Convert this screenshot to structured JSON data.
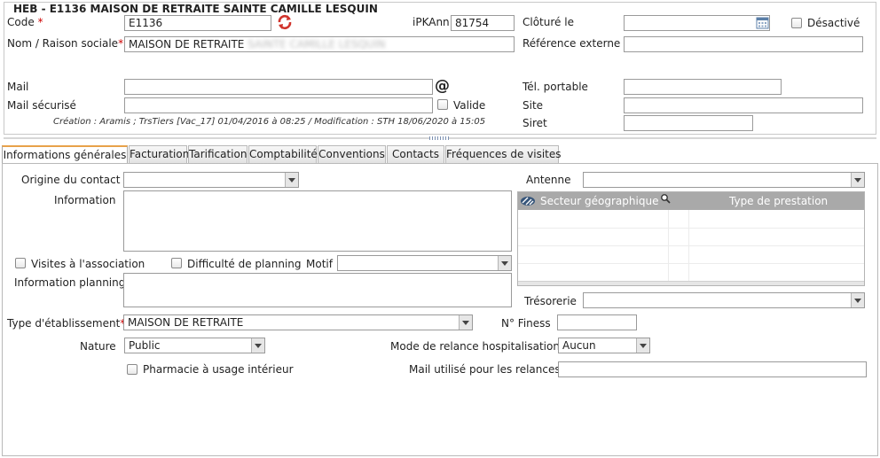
{
  "header": {
    "title": "HEB - E1136 MAISON DE RETRAITE SAINTE CAMILLE LESQUIN",
    "code_label": "Code",
    "code_value": "E1136",
    "ipkann_label": "iPKAnn",
    "ipkann_value": "81754",
    "cloture_label": "Clôturé le",
    "cloture_value": "",
    "desactive_label": "Désactivé",
    "nom_label": "Nom / Raison sociale",
    "nom_value": "MAISON DE RETRAITE",
    "nom_value_blurred": "SAINTE CAMILLE LESQUIN",
    "ref_externe_label": "Référence externe",
    "ref_externe_value": "",
    "mail_label": "Mail",
    "mail_value": "",
    "mail_securise_label": "Mail sécurisé",
    "mail_securise_value": "",
    "valide_label": "Valide",
    "tel_portable_label": "Tél. portable",
    "tel_portable_value": "",
    "site_label": "Site",
    "site_value": "",
    "siret_label": "Siret",
    "siret_value": "",
    "creation_info": "Création : Aramis ; TrsTiers [Vac_17] 01/04/2016 à 08:25 / Modification : STH 18/06/2020 à 15:05",
    "at_symbol": "@"
  },
  "tabs": [
    {
      "label": "Informations générales",
      "active": true
    },
    {
      "label": "Facturation"
    },
    {
      "label": "Tarification"
    },
    {
      "label": "Comptabilité"
    },
    {
      "label": "Conventions"
    },
    {
      "label": "Contacts"
    },
    {
      "label": "Fréquences de visites"
    }
  ],
  "general": {
    "origine_label": "Origine du contact",
    "origine_value": "",
    "information_label": "Information",
    "information_value": "",
    "visites_label": "Visites à l'association",
    "difficulte_label": "Difficulté de planning",
    "motif_label": "Motif",
    "motif_value": "",
    "info_planning_label": "Information planning",
    "info_planning_value": "",
    "type_etab_label": "Type d'établissement",
    "type_etab_value": "MAISON DE RETRAITE",
    "finess_label": "N° Finess",
    "finess_value": "",
    "nature_label": "Nature",
    "nature_value": "Public",
    "mode_relance_label": "Mode de relance hospitalisation",
    "mode_relance_value": "Aucun",
    "pharmacie_label": "Pharmacie à usage intérieur",
    "mail_relances_label": "Mail utilisé pour les relances",
    "mail_relances_value": "",
    "antenne_label": "Antenne",
    "antenne_value": "",
    "grid_col1": "Secteur géographique",
    "grid_col2": "Type de prestation",
    "tresorerie_label": "Trésorerie",
    "tresorerie_value": ""
  },
  "colors": {
    "required": "#cc0000",
    "grid_header": "#a9a9a9",
    "tab_active_accent": "#e8a24a"
  }
}
